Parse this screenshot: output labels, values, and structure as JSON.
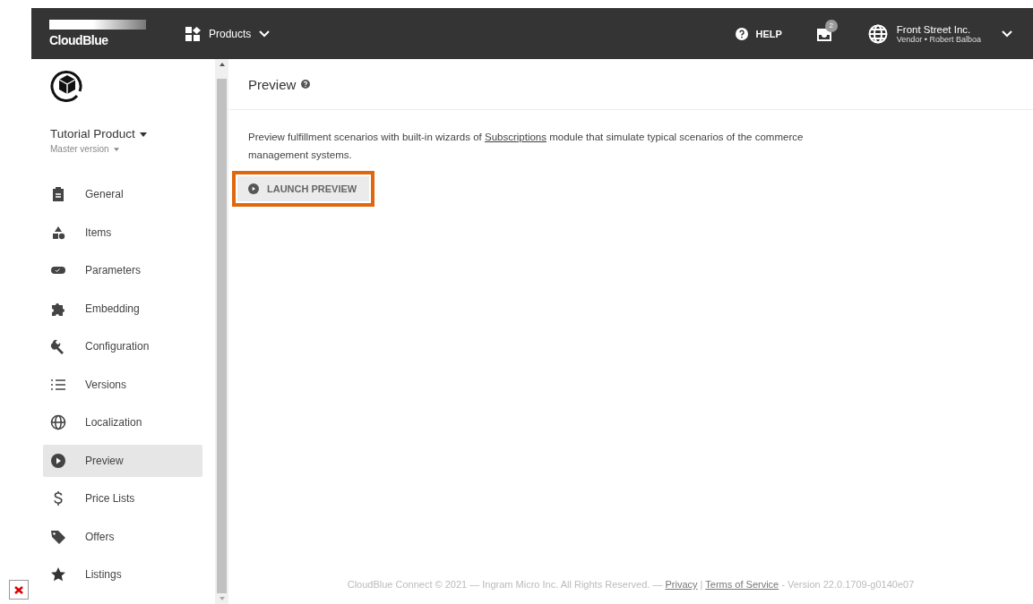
{
  "header": {
    "logo": "CloudBlue",
    "module": "Products",
    "help": "HELP",
    "notifications_count": "2",
    "account": {
      "name": "Front Street Inc.",
      "role": "Vendor • Robert Balboa"
    }
  },
  "sidebar": {
    "product": "Tutorial Product",
    "version": "Master version",
    "items": [
      {
        "label": "General",
        "selected": false
      },
      {
        "label": "Items",
        "selected": false
      },
      {
        "label": "Parameters",
        "selected": false
      },
      {
        "label": "Embedding",
        "selected": false
      },
      {
        "label": "Configuration",
        "selected": false
      },
      {
        "label": "Versions",
        "selected": false
      },
      {
        "label": "Localization",
        "selected": false
      },
      {
        "label": "Preview",
        "selected": true
      },
      {
        "label": "Price Lists",
        "selected": false
      },
      {
        "label": "Offers",
        "selected": false
      },
      {
        "label": "Listings",
        "selected": false
      }
    ]
  },
  "page": {
    "title": "Preview",
    "description": {
      "before": "Preview fulfillment scenarios with built-in wizards of ",
      "link": "Subscriptions",
      "after": " module that simulate typical scenarios of the commerce management systems."
    },
    "button": "LAUNCH PREVIEW"
  },
  "footer": {
    "copyright": "CloudBlue Connect © 2021 — Ingram Micro Inc. All Rights Reserved. — ",
    "privacy": "Privacy",
    "separator": "|",
    "terms": "Terms of Service",
    "version": "- Version 22.0.1709-g0140e07"
  }
}
